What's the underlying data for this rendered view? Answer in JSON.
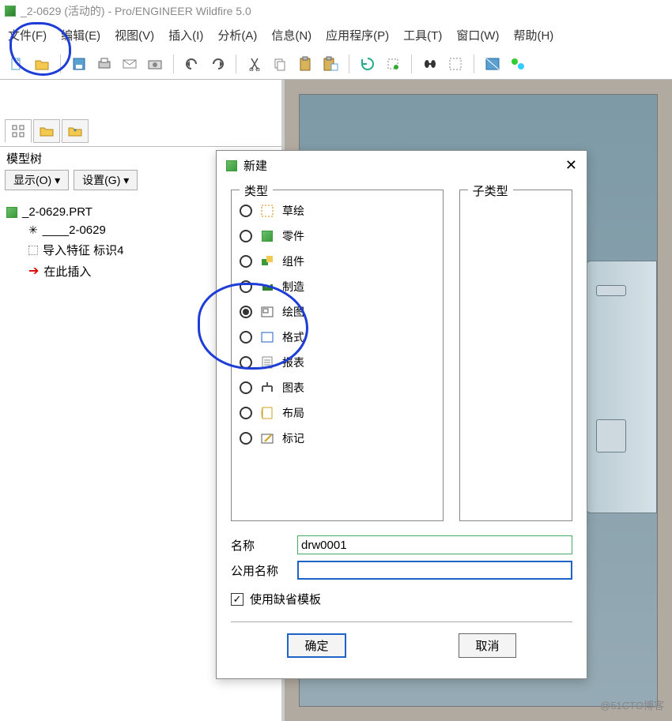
{
  "window": {
    "title": "_2-0629 (活动的) - Pro/ENGINEER Wildfire 5.0"
  },
  "menu": {
    "file": "文件(F)",
    "edit": "编辑(E)",
    "view": "视图(V)",
    "insert": "插入(I)",
    "analysis": "分析(A)",
    "info": "信息(N)",
    "apps": "应用程序(P)",
    "tools": "工具(T)",
    "window": "窗口(W)",
    "help": "帮助(H)"
  },
  "left": {
    "tree_title": "模型树",
    "show_btn": "显示(O) ▾",
    "settings_btn": "设置(G) ▾",
    "root": "_2-0629.PRT",
    "n1": "____2-0629",
    "n2": "导入特征 标识4",
    "n3": "在此插入"
  },
  "dialog": {
    "title": "新建",
    "type_label": "类型",
    "subtype_label": "子类型",
    "options": {
      "sketch": "草绘",
      "part": "零件",
      "assembly": "组件",
      "mfg": "制造",
      "drawing": "绘图",
      "format": "格式",
      "report": "报表",
      "diagram": "图表",
      "layout": "布局",
      "markup": "标记"
    },
    "selected": "drawing",
    "name_label": "名称",
    "common_label": "公用名称",
    "name_value": "drw0001",
    "common_value": "",
    "use_default": "使用缺省模板",
    "use_default_checked": true,
    "ok": "确定",
    "cancel": "取消"
  },
  "watermark": "@51CTO博客"
}
